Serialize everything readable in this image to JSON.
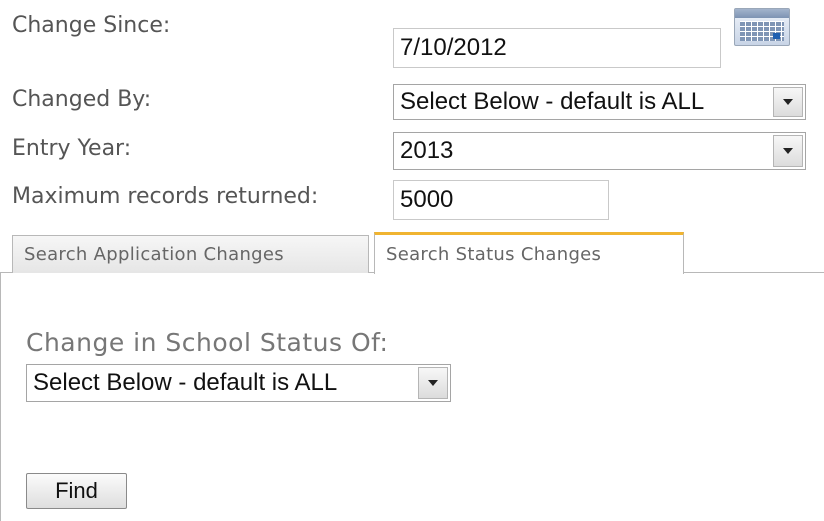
{
  "form": {
    "change_since": {
      "label": "Change Since:",
      "value": "7/10/2012"
    },
    "changed_by": {
      "label": "Changed By:",
      "selected": "Select Below - default is ALL"
    },
    "entry_year": {
      "label": "Entry Year:",
      "selected": "2013"
    },
    "max_records": {
      "label": "Maximum records returned:",
      "value": "5000"
    }
  },
  "tabs": [
    {
      "label": "Search Application Changes",
      "active": false
    },
    {
      "label": "Search Status Changes",
      "active": true
    }
  ],
  "status_tab": {
    "section_label": "Change in School Status Of:",
    "status_select": "Select Below - default is ALL",
    "find_label": "Find"
  },
  "icons": {
    "calendar": "calendar-icon",
    "dropdown": "chevron-down-icon"
  },
  "colors": {
    "active_tab_accent": "#f0b431",
    "label_text": "#555555"
  }
}
